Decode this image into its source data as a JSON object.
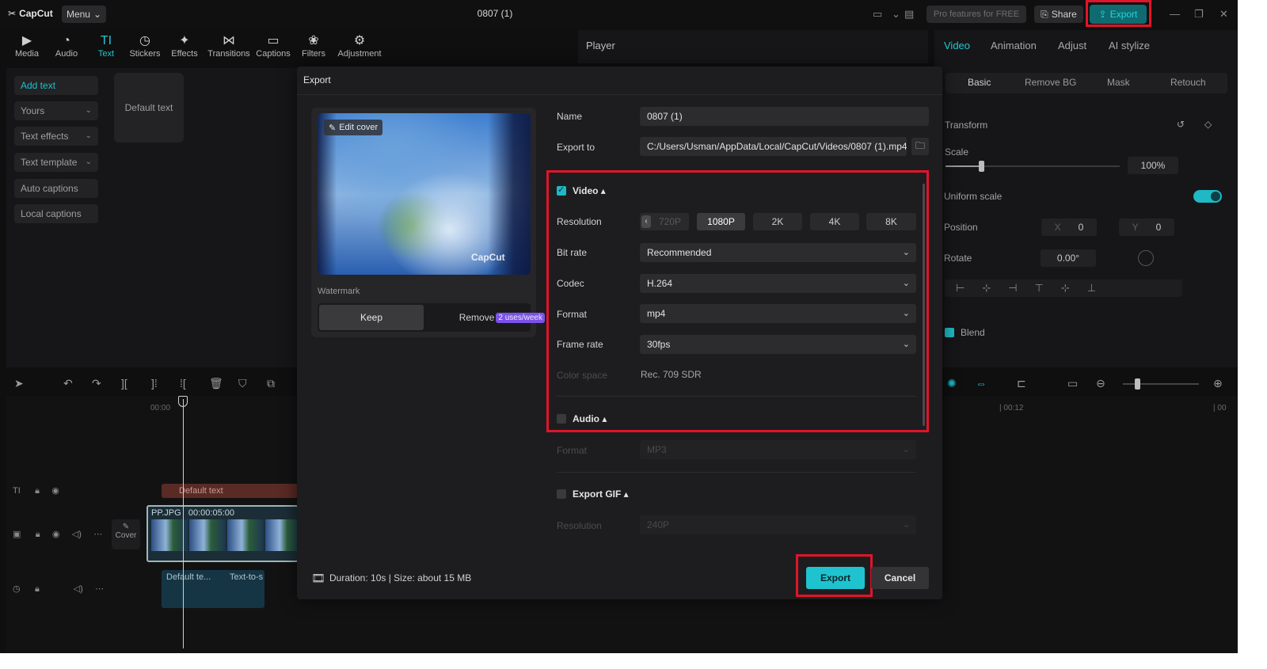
{
  "app": {
    "logo": "CapCut",
    "menu_label": "Menu",
    "project_title": "0807 (1)",
    "pro_features": "Pro features for FREE",
    "share_label": "Share",
    "export_label": "Export"
  },
  "toolbar": {
    "items": [
      {
        "label": "Media",
        "icon": "media-icon"
      },
      {
        "label": "Audio",
        "icon": "audio-icon"
      },
      {
        "label": "Text",
        "icon": "text-icon"
      },
      {
        "label": "Stickers",
        "icon": "sticker-icon"
      },
      {
        "label": "Effects",
        "icon": "effects-icon"
      },
      {
        "label": "Transitions",
        "icon": "transitions-icon"
      },
      {
        "label": "Captions",
        "icon": "captions-icon"
      },
      {
        "label": "Filters",
        "icon": "filters-icon"
      },
      {
        "label": "Adjustment",
        "icon": "adjustment-icon"
      }
    ],
    "active": "Text"
  },
  "sidebar": {
    "items": [
      {
        "label": "Add text"
      },
      {
        "label": "Yours"
      },
      {
        "label": "Text effects"
      },
      {
        "label": "Text template"
      },
      {
        "label": "Auto captions"
      },
      {
        "label": "Local captions"
      }
    ],
    "default_text_card": "Default text"
  },
  "player": {
    "title": "Player"
  },
  "right_panel": {
    "tabs": [
      "Video",
      "Animation",
      "Adjust",
      "AI stylize"
    ],
    "subtabs": [
      "Basic",
      "Remove BG",
      "Mask",
      "Retouch"
    ],
    "transform_label": "Transform",
    "scale_label": "Scale",
    "scale_value": "100%",
    "uniform_scale_label": "Uniform scale",
    "position_label": "Position",
    "pos_x_label": "X",
    "pos_x": "0",
    "pos_y_label": "Y",
    "pos_y": "0",
    "rotate_label": "Rotate",
    "rotate_value": "0.00°",
    "blend_label": "Blend"
  },
  "timeline": {
    "ruler_start": "00:00",
    "ruler_mid": "| 00:12",
    "ruler_end": "| 00",
    "text_clip": "Default text",
    "video_clip_name": "PP.JPG",
    "video_clip_time": "00:00:05:00",
    "cover_label": "Cover",
    "audio_clip_1": "Default te...",
    "audio_clip_2": "Text-to-s"
  },
  "export_dialog": {
    "title": "Export",
    "edit_cover": "Edit cover",
    "watermark_text": "CapCut",
    "watermark_label": "Watermark",
    "keep_label": "Keep",
    "remove_label": "Remove",
    "remove_badge": "2 uses/week",
    "name_label": "Name",
    "name_value": "0807 (1)",
    "export_to_label": "Export to",
    "export_to_value": "C:/Users/Usman/AppData/Local/CapCut/Videos/0807 (1).mp4",
    "video_section": "Video ▴",
    "resolution_label": "Resolution",
    "resolutions": [
      "720P",
      "1080P",
      "2K",
      "4K",
      "8K"
    ],
    "resolution_selected": "1080P",
    "bitrate_label": "Bit rate",
    "bitrate_value": "Recommended",
    "codec_label": "Codec",
    "codec_value": "H.264",
    "format_label": "Format",
    "format_value": "mp4",
    "framerate_label": "Frame rate",
    "framerate_value": "30fps",
    "colorspace_label": "Color space",
    "colorspace_value": "Rec. 709 SDR",
    "audio_section": "Audio ▴",
    "audio_format_label": "Format",
    "audio_format_value": "MP3",
    "gif_section": "Export GIF ▴",
    "gif_resolution_label": "Resolution",
    "gif_resolution_value": "240P",
    "footer_info": "Duration: 10s | Size: about 15 MB",
    "export_button": "Export",
    "cancel_button": "Cancel"
  },
  "colors": {
    "accent": "#1fc3cf",
    "highlight_box": "#e0142a",
    "badge": "#7b52e8"
  }
}
